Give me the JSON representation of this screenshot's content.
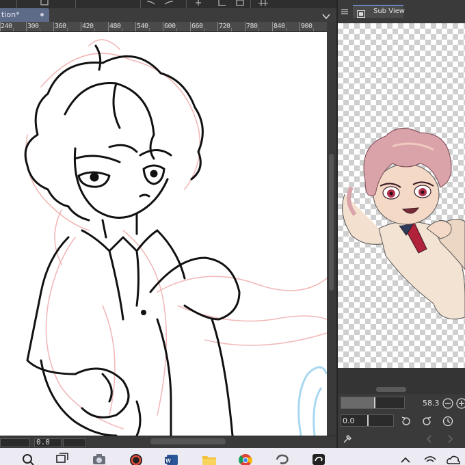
{
  "document_tab": {
    "label": "tion*"
  },
  "ruler": {
    "labels": [
      "240",
      "300",
      "360",
      "420",
      "480",
      "540",
      "600",
      "660",
      "720",
      "780",
      "840",
      "900"
    ]
  },
  "subview": {
    "tab_label": "Sub View"
  },
  "navigator": {
    "zoom_value": "58.3",
    "rotation_value": "0.0"
  },
  "status": {
    "angle_value": "0.0"
  },
  "colors": {
    "accent": "#6a86b8",
    "tab_active": "#5d6b88",
    "panel_bg": "#3a3a3a",
    "sketch_pink": "#f2b8b8",
    "sketch_blue": "#a7d8f0"
  },
  "icons": {
    "toolbar": [
      "undo-icon",
      "ruler-icon",
      "transform-icon",
      "grid-icon"
    ],
    "taskbar": [
      "search-icon",
      "task-view-icon",
      "camera-icon",
      "app-circle-icon",
      "word-icon",
      "file-explorer-icon",
      "chrome-icon",
      "clip-studio-icon",
      "clip-studio-alt-icon",
      "chevron-up-icon",
      "wifi-icon",
      "cloud-icon"
    ]
  }
}
